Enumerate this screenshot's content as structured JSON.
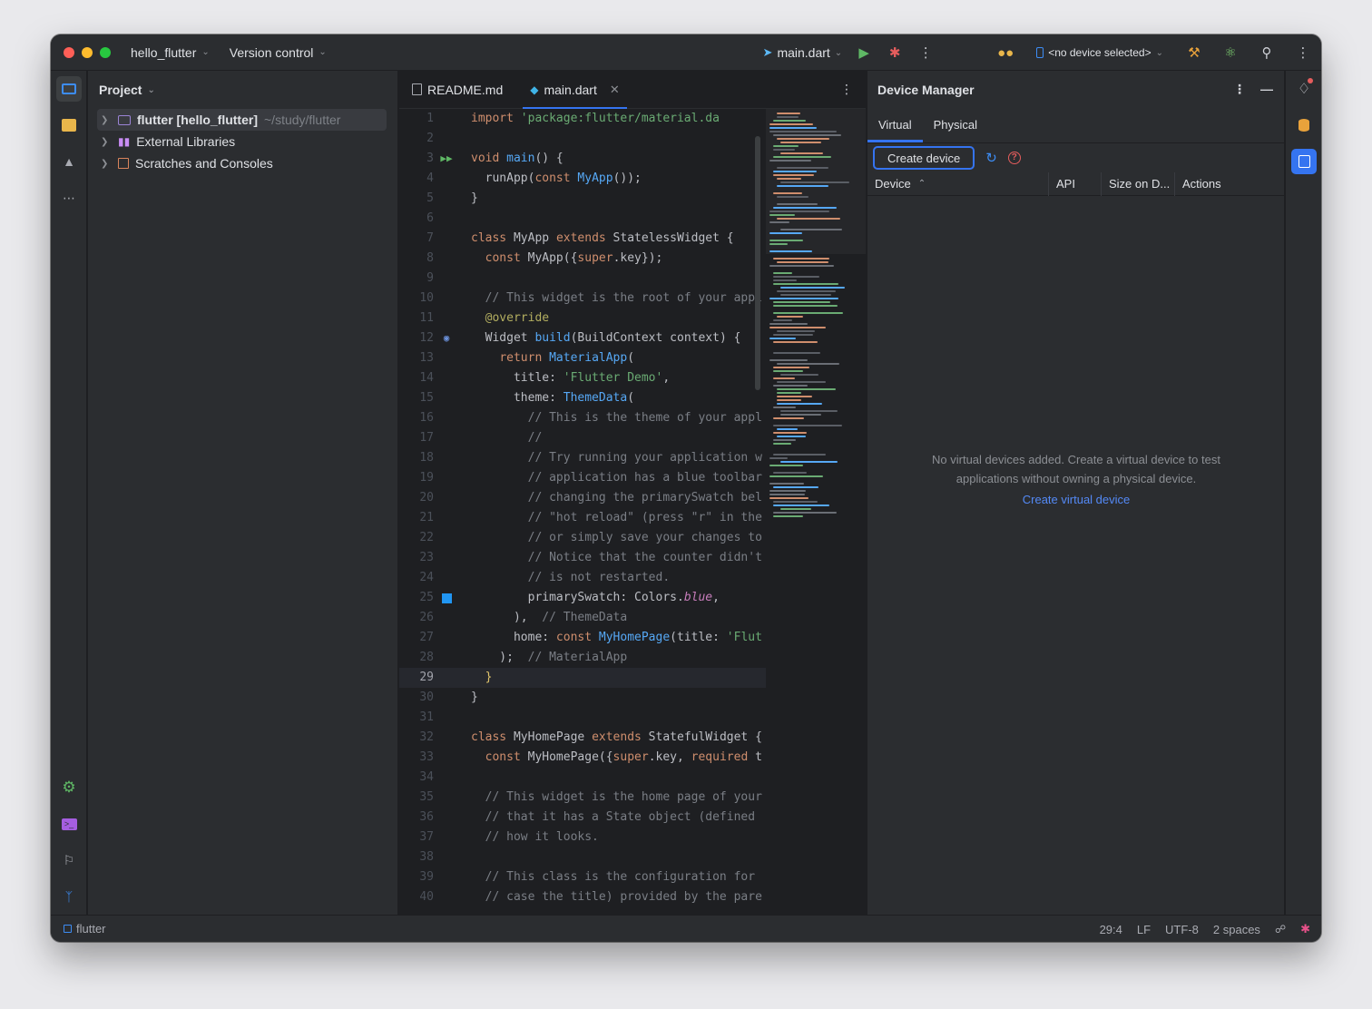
{
  "titlebar": {
    "project_name": "hello_flutter",
    "vcs_label": "Version control",
    "run_config": "main.dart",
    "device_selector": "<no device selected>"
  },
  "project_panel": {
    "title": "Project",
    "tree": [
      {
        "label": "flutter [hello_flutter]",
        "hint": "~/study/flutter"
      },
      {
        "label": "External Libraries",
        "hint": ""
      },
      {
        "label": "Scratches and Consoles",
        "hint": ""
      }
    ]
  },
  "editor": {
    "tabs": [
      {
        "label": "README.md"
      },
      {
        "label": "main.dart"
      }
    ],
    "current_line": 29
  },
  "device_manager": {
    "title": "Device Manager",
    "tabs": [
      "Virtual",
      "Physical"
    ],
    "create_button": "Create device",
    "columns": [
      "Device",
      "API",
      "Size on D...",
      "Actions"
    ],
    "empty_message_1": "No virtual devices added. Create a virtual device to test",
    "empty_message_2": "applications without owning a physical device.",
    "empty_link": "Create virtual device"
  },
  "statusbar": {
    "project": "flutter",
    "position": "29:4",
    "line_sep": "LF",
    "encoding": "UTF-8",
    "indent": "2 spaces"
  },
  "colors": {
    "accent": "#3574f0",
    "background": "#1e1f22",
    "panel": "#2b2d30"
  }
}
